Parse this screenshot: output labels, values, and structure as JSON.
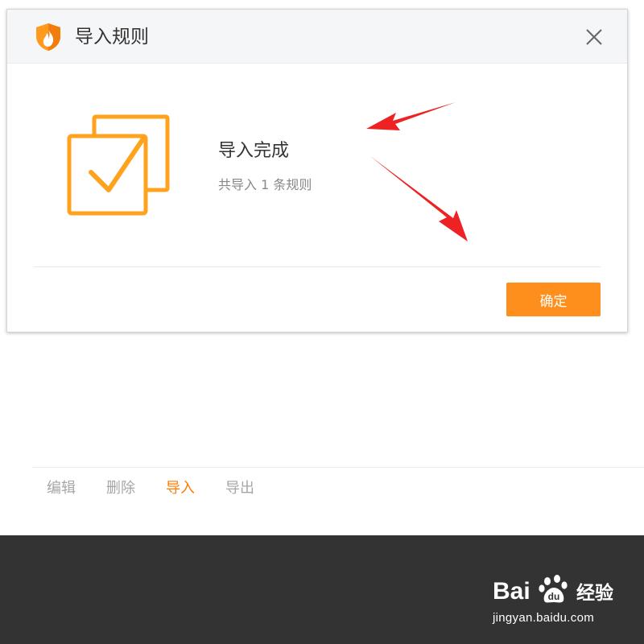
{
  "dialog": {
    "title": "导入规则",
    "icons": {
      "app": "shield-flame-icon",
      "close": "close-icon",
      "result": "double-square-check-icon"
    },
    "result_title": "导入完成",
    "result_subtitle": "共导入 1 条规则",
    "ok_label": "确定"
  },
  "toolbar": {
    "items": [
      {
        "label": "编辑",
        "active": false
      },
      {
        "label": "删除",
        "active": false
      },
      {
        "label": "导入",
        "active": true
      },
      {
        "label": "导出",
        "active": false
      }
    ]
  },
  "watermark": {
    "brand_bai": "Bai",
    "brand_jingyan": "经验",
    "url": "jingyan.baidu.com"
  },
  "colors": {
    "accent": "#ff8f1c",
    "active_link": "#ff7a00",
    "annotation_arrow": "#ee2222",
    "footer": "#333333"
  }
}
